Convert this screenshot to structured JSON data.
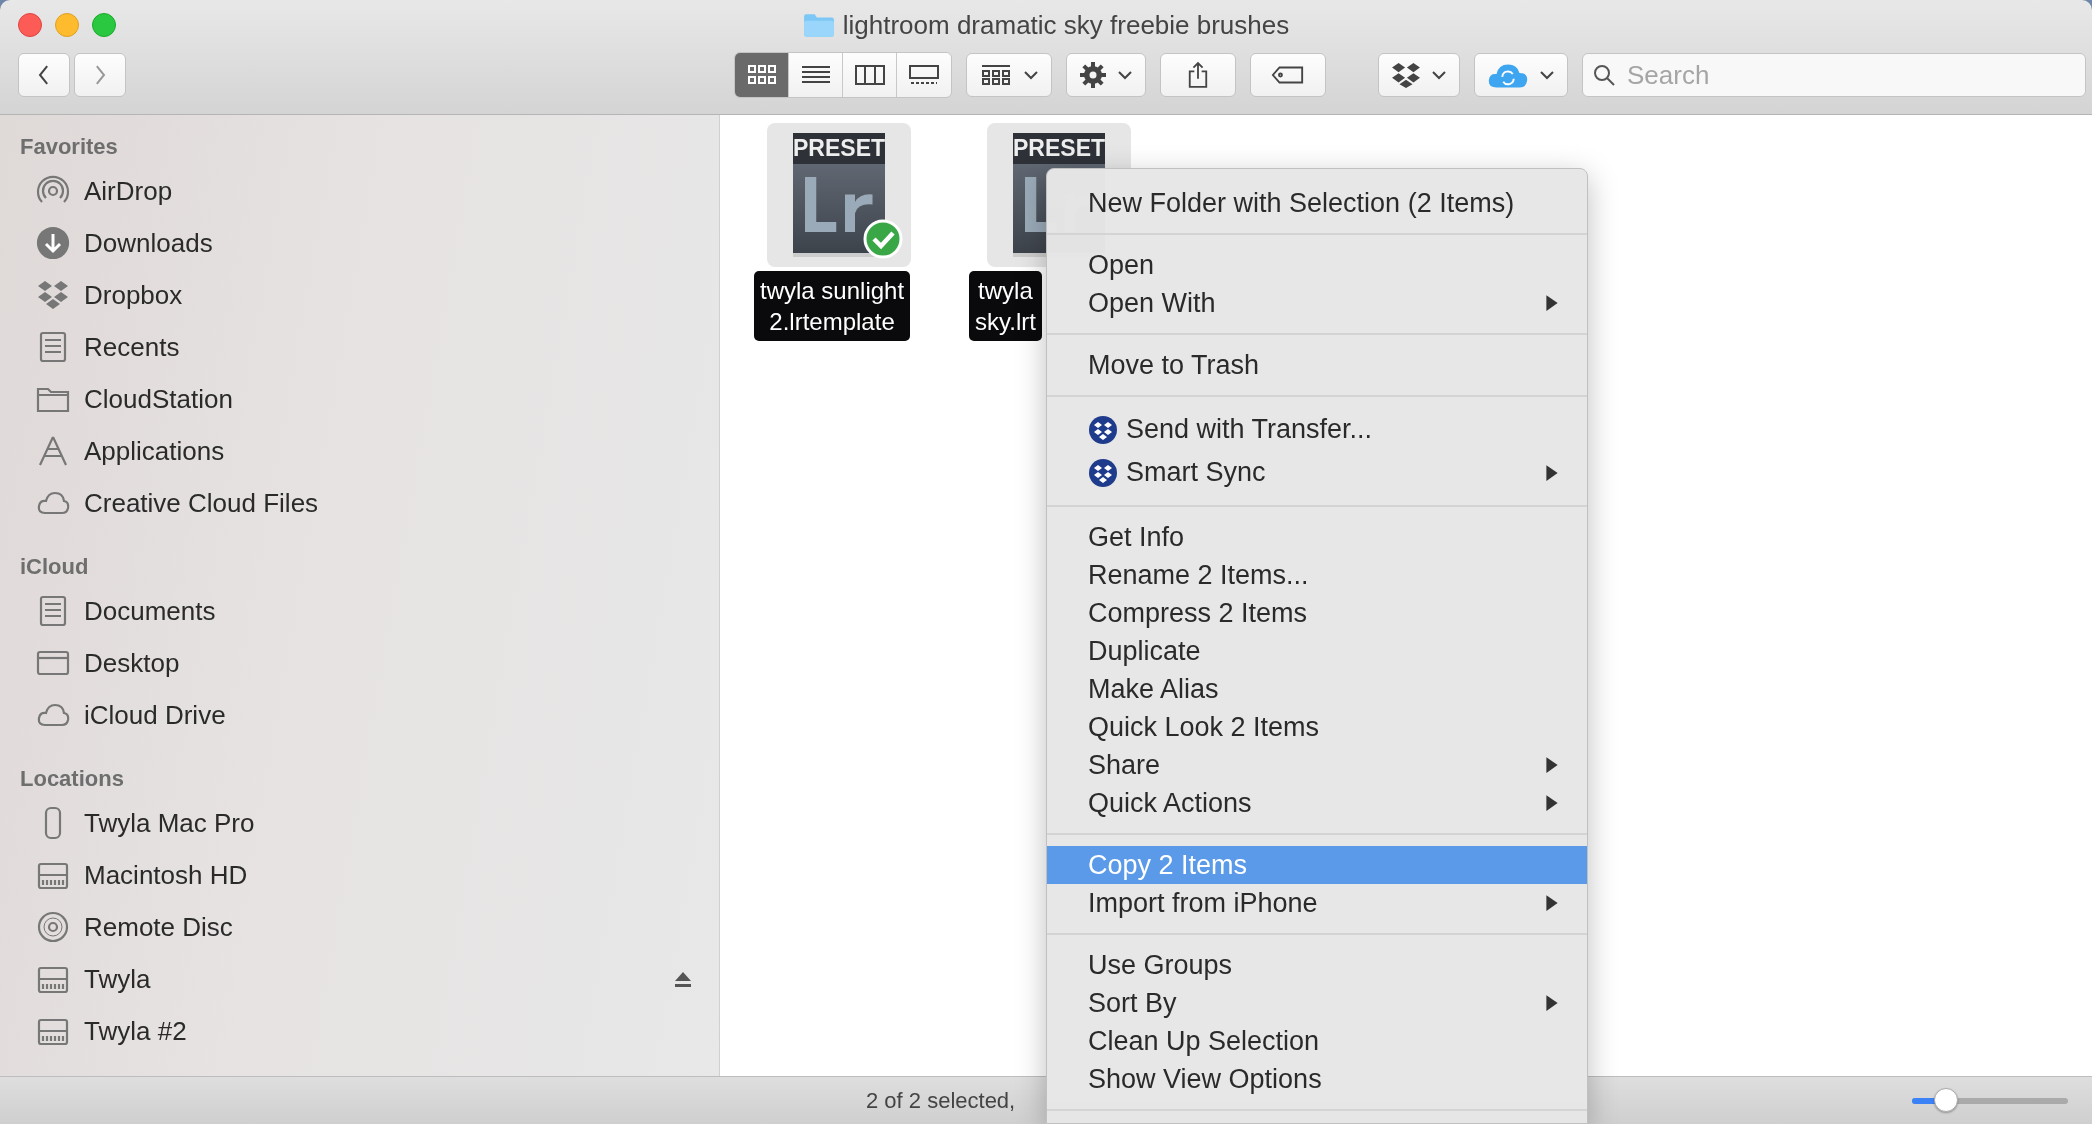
{
  "window": {
    "title": "lightroom dramatic sky freebie brushes"
  },
  "toolbar": {
    "views": [
      {
        "selected": true
      },
      {
        "selected": false
      },
      {
        "selected": false
      },
      {
        "selected": false
      }
    ],
    "search": {
      "placeholder": "Search"
    }
  },
  "sidebar": {
    "sections": [
      {
        "title": "Favorites",
        "items": [
          {
            "label": "AirDrop",
            "ejectable": false
          },
          {
            "label": "Downloads",
            "ejectable": false
          },
          {
            "label": "Dropbox",
            "ejectable": false
          },
          {
            "label": "Recents",
            "ejectable": false
          },
          {
            "label": "CloudStation",
            "ejectable": false
          },
          {
            "label": "Applications",
            "ejectable": false
          },
          {
            "label": "Creative Cloud Files",
            "ejectable": false
          }
        ]
      },
      {
        "title": "iCloud",
        "items": [
          {
            "label": "Documents",
            "ejectable": false
          },
          {
            "label": "Desktop",
            "ejectable": false
          },
          {
            "label": "iCloud Drive",
            "ejectable": false
          }
        ]
      },
      {
        "title": "Locations",
        "items": [
          {
            "label": "Twyla Mac Pro",
            "ejectable": false
          },
          {
            "label": "Macintosh HD",
            "ejectable": false
          },
          {
            "label": "Remote Disc",
            "ejectable": false
          },
          {
            "label": "Twyla",
            "ejectable": true
          },
          {
            "label": "Twyla #2",
            "ejectable": false
          }
        ]
      }
    ]
  },
  "files": [
    {
      "badge_text": "PRESET",
      "name_lines": [
        "twyla sunlight",
        "2.lrtemplate"
      ],
      "selected": true,
      "synced": true
    },
    {
      "badge_text": "PRESET",
      "name_lines": [
        "twyla",
        "sky.lrt"
      ],
      "selected": true,
      "synced": false
    }
  ],
  "context_menu": {
    "groups": [
      [
        {
          "label": "New Folder with Selection (2 Items)",
          "kind": "text",
          "submenu": false,
          "selected": false
        }
      ],
      [
        {
          "label": "Open",
          "kind": "text",
          "submenu": false,
          "selected": false
        },
        {
          "label": "Open With",
          "kind": "text",
          "submenu": true,
          "selected": false
        }
      ],
      [
        {
          "label": "Move to Trash",
          "kind": "text",
          "submenu": false,
          "selected": false
        }
      ],
      [
        {
          "label": "Send with Transfer...",
          "kind": "icon",
          "submenu": false,
          "selected": false
        },
        {
          "label": "Smart Sync",
          "kind": "icon",
          "submenu": true,
          "selected": false
        }
      ],
      [
        {
          "label": "Get Info",
          "kind": "text",
          "submenu": false,
          "selected": false
        },
        {
          "label": "Rename 2 Items...",
          "kind": "text",
          "submenu": false,
          "selected": false
        },
        {
          "label": "Compress 2 Items",
          "kind": "text",
          "submenu": false,
          "selected": false
        },
        {
          "label": "Duplicate",
          "kind": "text",
          "submenu": false,
          "selected": false
        },
        {
          "label": "Make Alias",
          "kind": "text",
          "submenu": false,
          "selected": false
        },
        {
          "label": "Quick Look 2 Items",
          "kind": "text",
          "submenu": false,
          "selected": false
        },
        {
          "label": "Share",
          "kind": "text",
          "submenu": true,
          "selected": false
        },
        {
          "label": "Quick Actions",
          "kind": "text",
          "submenu": true,
          "selected": false
        }
      ],
      [
        {
          "label": "Copy 2 Items",
          "kind": "text",
          "submenu": false,
          "selected": true
        },
        {
          "label": "Import from iPhone",
          "kind": "text",
          "submenu": true,
          "selected": false
        }
      ],
      [
        {
          "label": "Use Groups",
          "kind": "text",
          "submenu": false,
          "selected": false
        },
        {
          "label": "Sort By",
          "kind": "text",
          "submenu": true,
          "selected": false
        },
        {
          "label": "Clean Up Selection",
          "kind": "text",
          "submenu": false,
          "selected": false
        },
        {
          "label": "Show View Options",
          "kind": "text",
          "submenu": false,
          "selected": false
        }
      ]
    ]
  },
  "status_bar": {
    "text": "2 of 2 selected,",
    "zoom": {
      "level": 0.22
    }
  }
}
